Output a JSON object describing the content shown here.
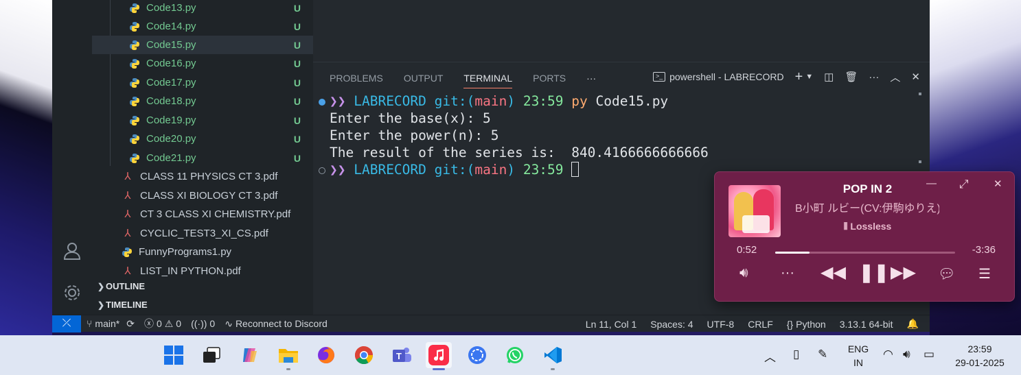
{
  "explorer": {
    "python_files": [
      {
        "name": "Code13.py",
        "badge": "U"
      },
      {
        "name": "Code14.py",
        "badge": "U"
      },
      {
        "name": "Code15.py",
        "badge": "U"
      },
      {
        "name": "Code16.py",
        "badge": "U"
      },
      {
        "name": "Code17.py",
        "badge": "U"
      },
      {
        "name": "Code18.py",
        "badge": "U"
      },
      {
        "name": "Code19.py",
        "badge": "U"
      },
      {
        "name": "Code20.py",
        "badge": "U"
      },
      {
        "name": "Code21.py",
        "badge": "U"
      }
    ],
    "other_files": [
      "CLASS 11 PHYSICS CT 3.pdf",
      "CLASS XI BIOLOGY  CT 3.pdf",
      "CT 3 CLASS  XI CHEMISTRY.pdf",
      "CYCLIC_TEST3_XI_CS.pdf",
      "FunnyPrograms1.py",
      "LIST_IN PYTHON.pdf"
    ],
    "sections": {
      "outline": "OUTLINE",
      "timeline": "TIMELINE"
    }
  },
  "panel": {
    "tabs": [
      "PROBLEMS",
      "OUTPUT",
      "TERMINAL",
      "PORTS"
    ],
    "active_tab": "TERMINAL",
    "more": "···",
    "terminal_name": "powershell - LABRECORD"
  },
  "terminal": {
    "prompt_arrow": "❯❯",
    "dir": "LABRECORD",
    "git_prefix": "git:(",
    "branch": "main",
    "git_suffix": ")",
    "time": "23:59",
    "cmd": "py",
    "cmd_arg": "Code15.py",
    "output": [
      "Enter the base(x): 5",
      "Enter the power(n): 5",
      "The result of the series is:  840.4166666666666"
    ]
  },
  "statusbar": {
    "branch": "main*",
    "errors": "0",
    "warnings": "0",
    "ports": "0",
    "discord": "Reconnect to Discord",
    "position": "Ln 11, Col 1",
    "spaces": "Spaces: 4",
    "encoding": "UTF-8",
    "eol": "CRLF",
    "language": "Python",
    "interpreter": "3.13.1 64-bit"
  },
  "player": {
    "title": "POP IN 2",
    "artist": "B小町 ルビー(CV:伊駒ゆりえ)",
    "quality": "Lossless",
    "elapsed": "0:52",
    "remaining": "-3:36",
    "progress": 0.19
  },
  "taskbar": {
    "apps": [
      "start",
      "task-view",
      "copilot",
      "file-explorer",
      "firefox",
      "chrome",
      "teams",
      "apple-music",
      "signal",
      "whatsapp",
      "vscode"
    ],
    "lang_line1": "ENG",
    "lang_line2": "IN",
    "time": "23:59",
    "date": "29-01-2025"
  },
  "colors": {
    "accent": "#0366d6",
    "untracked": "#73c991",
    "player_bg": "#6e1f48"
  }
}
